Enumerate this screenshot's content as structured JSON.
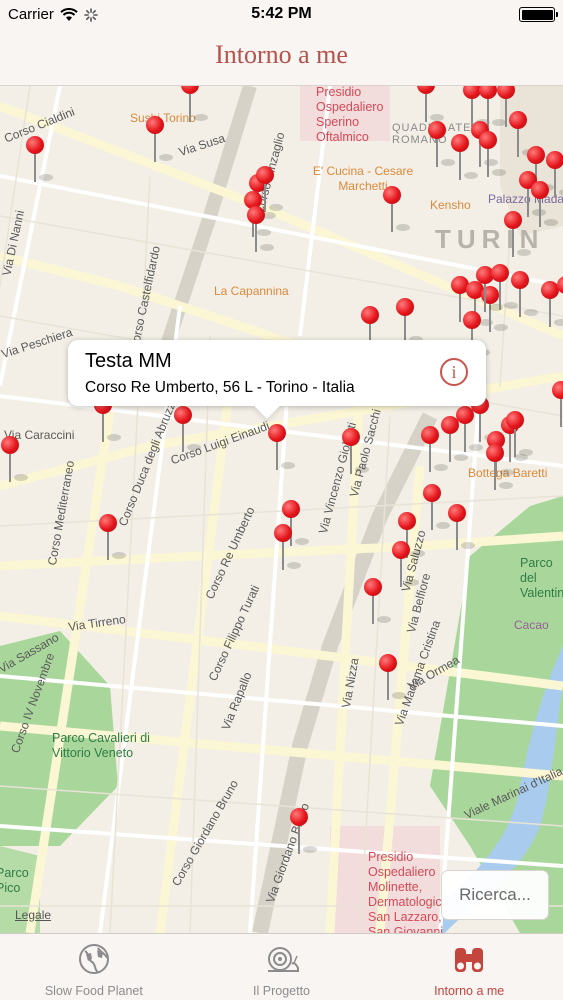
{
  "status_bar": {
    "carrier": "Carrier",
    "time": "5:42 PM"
  },
  "nav": {
    "title": "Intorno a me"
  },
  "map": {
    "city_label": "TURIN",
    "street_labels": [
      "Corso Cialdini",
      "Corso Vinzaglio",
      "Via Susa",
      "Corso Castelfidardo",
      "Via Di Nanni",
      "Via Peschiera",
      "Via Caraccini",
      "Corso Mediterraneo",
      "Corso Duca degli Abruzzi",
      "Corso Luigi Einaudi",
      "Via Vincenzo Gioberti",
      "Via Paolo Sacchi",
      "Corso Re Umberto",
      "Via Tirreno",
      "Corso Filippo Turati",
      "Via Nizza",
      "Via Madama Cristina",
      "Via Belfiore",
      "Via Saluzzo",
      "Via Ormea",
      "Via Rapallo",
      "Corso Giordano Bruno",
      "Via Giordano Bruno",
      "Corso IV Novembre",
      "Viale Marinai d'Italia",
      "Via Sassano"
    ],
    "poi_labels": [
      "Sushi Torino",
      "La Capannina",
      "E' Cucina - Cesare Marchetti",
      "Kensho",
      "Bottega Baretti",
      "Cacao",
      "Palazzo Madama"
    ],
    "hospital_top": "Presidio Ospedaliero Sperino Oftalmico",
    "hospital_bottom": "Presidio Ospedaliero Molinette, Dermatologico San Lazzaro, San Giovanni",
    "district": "QUADRILATERO ROMANO",
    "parks": {
      "park_cavalieri": "Parco Cavalieri di Vittorio Veneto",
      "park_valentino": "Parco del Valentino",
      "park_left": "Parco Pico"
    },
    "legal": "Legale",
    "search_button": "Ricerca..."
  },
  "callout": {
    "title": "Testa MM",
    "subtitle": "Corso Re Umberto, 56 L -  Torino  - Italia"
  },
  "tabs": [
    {
      "label": "Slow Food Planet",
      "icon": "globe-icon"
    },
    {
      "label": "Il Progetto",
      "icon": "snail-icon"
    },
    {
      "label": "Intorno a me",
      "icon": "binoculars-icon"
    }
  ],
  "colors": {
    "accent": "#c2453e",
    "pin": "#e4151b",
    "park": "#a9d79b",
    "river": "#a9ccee"
  }
}
